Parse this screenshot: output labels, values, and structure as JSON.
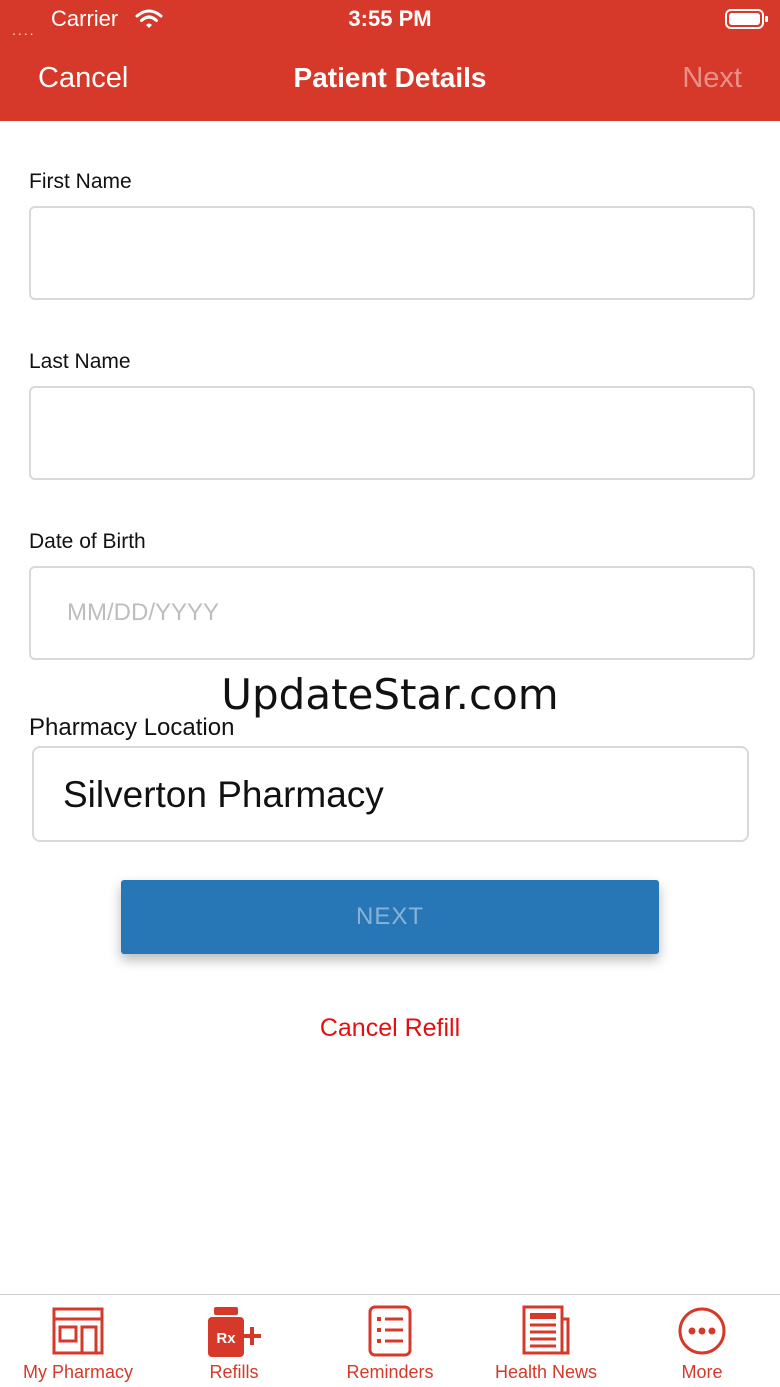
{
  "status_bar": {
    "carrier_dots": "....",
    "carrier": "Carrier",
    "time": "3:55 PM"
  },
  "nav": {
    "left": "Cancel",
    "title": "Patient Details",
    "right": "Next"
  },
  "form": {
    "first_name": {
      "label": "First Name",
      "value": "",
      "placeholder": ""
    },
    "last_name": {
      "label": "Last Name",
      "value": "",
      "placeholder": ""
    },
    "dob": {
      "label": "Date of Birth",
      "value": "",
      "placeholder": "MM/DD/YYYY"
    },
    "pharmacy": {
      "label": "Pharmacy Location",
      "value": "Silverton Pharmacy"
    }
  },
  "watermark": "UpdateStar.com",
  "buttons": {
    "next": "NEXT",
    "cancel_refill": "Cancel Refill"
  },
  "tabbar": {
    "items": [
      {
        "label": "My Pharmacy",
        "icon": "store-icon"
      },
      {
        "label": "Refills",
        "icon": "rx-refill-icon",
        "icon_text": "Rx"
      },
      {
        "label": "Reminders",
        "icon": "checklist-icon"
      },
      {
        "label": "Health News",
        "icon": "newspaper-icon"
      },
      {
        "label": "More",
        "icon": "more-icon"
      }
    ]
  },
  "colors": {
    "brand_red": "#d63829",
    "button_blue": "#2776b5",
    "cancel_red": "#e60f0f"
  }
}
